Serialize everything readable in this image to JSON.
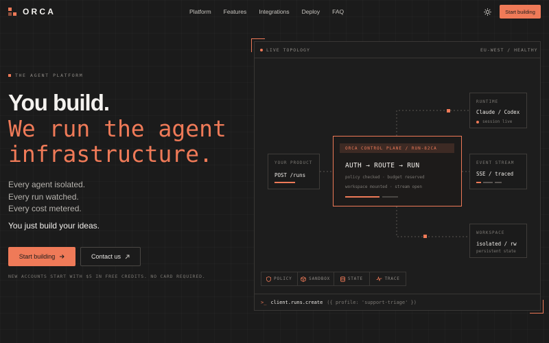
{
  "brand": {
    "name": "ORCA",
    "accent": "#ef7a58"
  },
  "nav": {
    "items": [
      "Platform",
      "Features",
      "Integrations",
      "Deploy",
      "FAQ"
    ],
    "cta": "Start building"
  },
  "hero": {
    "eyebrow": "THE AGENT PLATFORM",
    "title": "You build.",
    "subtitle_line1": "We run the agent",
    "subtitle_line2": "infrastructure.",
    "lines": [
      "Every agent isolated.",
      "Every run watched.",
      "Every cost metered."
    ],
    "lead": "You just build your ideas.",
    "primary_cta": "Start building",
    "secondary_cta": "Contact us",
    "fineprint": "NEW ACCOUNTS START WITH $5 IN FREE CREDITS. NO CARD REQUIRED."
  },
  "topology": {
    "label": "LIVE TOPOLOGY",
    "region": "EU-WEST / HEALTHY",
    "product": {
      "label": "YOUR PRODUCT",
      "value": "POST /runs"
    },
    "control": {
      "tag": "ORCA CONTROL PLANE / RUN-82CA",
      "title": "AUTH → ROUTE → RUN",
      "line1": "policy checked · budget reserved",
      "line2": "workspace mounted · stream open"
    },
    "runtime": {
      "label": "RUNTIME",
      "value": "Claude / Codex",
      "status": "session live"
    },
    "event": {
      "label": "EVENT STREAM",
      "value": "SSE / traced"
    },
    "workspace": {
      "label": "WORKSPACE",
      "value": "isolated / rw",
      "status": "persistent state"
    },
    "tabs": [
      {
        "label": "POLICY",
        "icon": "shield-icon"
      },
      {
        "label": "SANDBOX",
        "icon": "cube-icon"
      },
      {
        "label": "STATE",
        "icon": "database-icon"
      },
      {
        "label": "TRACE",
        "icon": "pulse-icon"
      }
    ],
    "console": {
      "prompt": ">_",
      "command": "client.runs.create",
      "args": "({ profile: 'support-triage' })"
    }
  }
}
